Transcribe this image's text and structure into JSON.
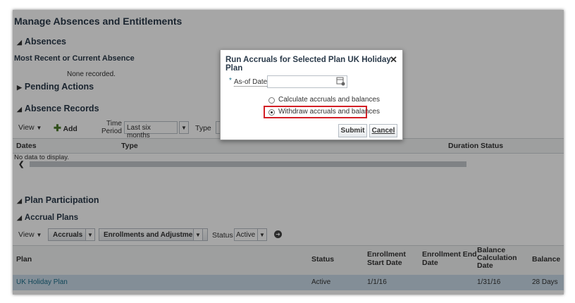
{
  "page_title": "Manage Absences and Entitlements",
  "absences": {
    "heading": "Absences",
    "recent_label": "Most Recent or Current Absence",
    "none": "None recorded."
  },
  "pending_actions": {
    "heading": "Pending Actions"
  },
  "absence_records": {
    "heading": "Absence Records",
    "view_label": "View",
    "add_label": "Add",
    "time_period_label_1": "Time",
    "time_period_label_2": "Period",
    "time_period_value": "Last six months",
    "type_label": "Type",
    "columns": {
      "dates": "Dates",
      "type": "Type",
      "duration": "Duration",
      "status": "Status"
    },
    "empty_text": "No data to display."
  },
  "plan_participation": {
    "heading": "Plan Participation",
    "accrual_heading": "Accrual Plans",
    "view_label": "View",
    "accruals_label": "Accruals",
    "enrollments_label": "Enrollments and Adjustments",
    "status_label": "Status",
    "status_value": "Active",
    "columns": {
      "plan": "Plan",
      "status": "Status",
      "enroll_start": [
        "Enrollment",
        "Start Date"
      ],
      "enroll_end": [
        "Enrollment End",
        "Date"
      ],
      "balance_calc": [
        "Balance",
        "Calculation",
        "Date"
      ],
      "balance": "Balance"
    },
    "row": {
      "plan": "UK Holiday Plan",
      "status": "Active",
      "start": "1/1/16",
      "end": "",
      "calc_date": "1/31/16",
      "balance": "28 Days"
    }
  },
  "dialog": {
    "title": "Run Accruals for Selected Plan UK Holiday Plan",
    "close": "✕",
    "as_of_label": "As-of Date",
    "required_mark": "*",
    "option1": "Calculate accruals and balances",
    "option2": "Withdraw accruals and balances",
    "selected": 2,
    "submit": "Submit",
    "cancel": "Cancel"
  },
  "colors": {
    "highlight": "#d31f26",
    "link": "#1c6e8a",
    "heading": "#2a3a4a",
    "row_selected": "#c9dbe8"
  }
}
